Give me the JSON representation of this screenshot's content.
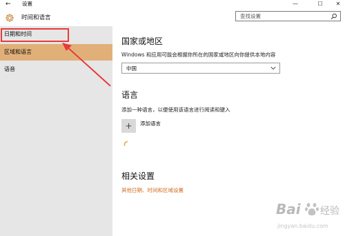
{
  "window": {
    "title": "设置",
    "back_glyph": "←",
    "minimize_glyph": "—",
    "maximize_glyph": "☐",
    "close_glyph": "✕"
  },
  "header": {
    "title": "时间和语言",
    "icon": "gear-icon"
  },
  "search": {
    "placeholder": "查找设置",
    "icon": "search-icon"
  },
  "sidebar": {
    "items": [
      {
        "label": "日期和时间",
        "selected": false
      },
      {
        "label": "区域和语言",
        "selected": true
      },
      {
        "label": "语音",
        "selected": false
      }
    ],
    "accent": "#e1b079"
  },
  "region": {
    "title": "国家或地区",
    "description": "Windows 和应用可能会根据你所在的国家或地区向你提供本地内容",
    "selected_value": "中国"
  },
  "language": {
    "title": "语言",
    "description": "添加一种语言，以便使用该语言进行阅读和键入",
    "add_label": "添加语言",
    "add_glyph": "+"
  },
  "related": {
    "title": "相关设置",
    "link": "其他日期、时间和区域设置",
    "link_color": "#d2691e"
  },
  "annotation": {
    "box_color": "#e63a3a"
  },
  "watermark": {
    "brand": "Bai",
    "brand2": "经验",
    "url": "jingyan.baidu.com"
  }
}
